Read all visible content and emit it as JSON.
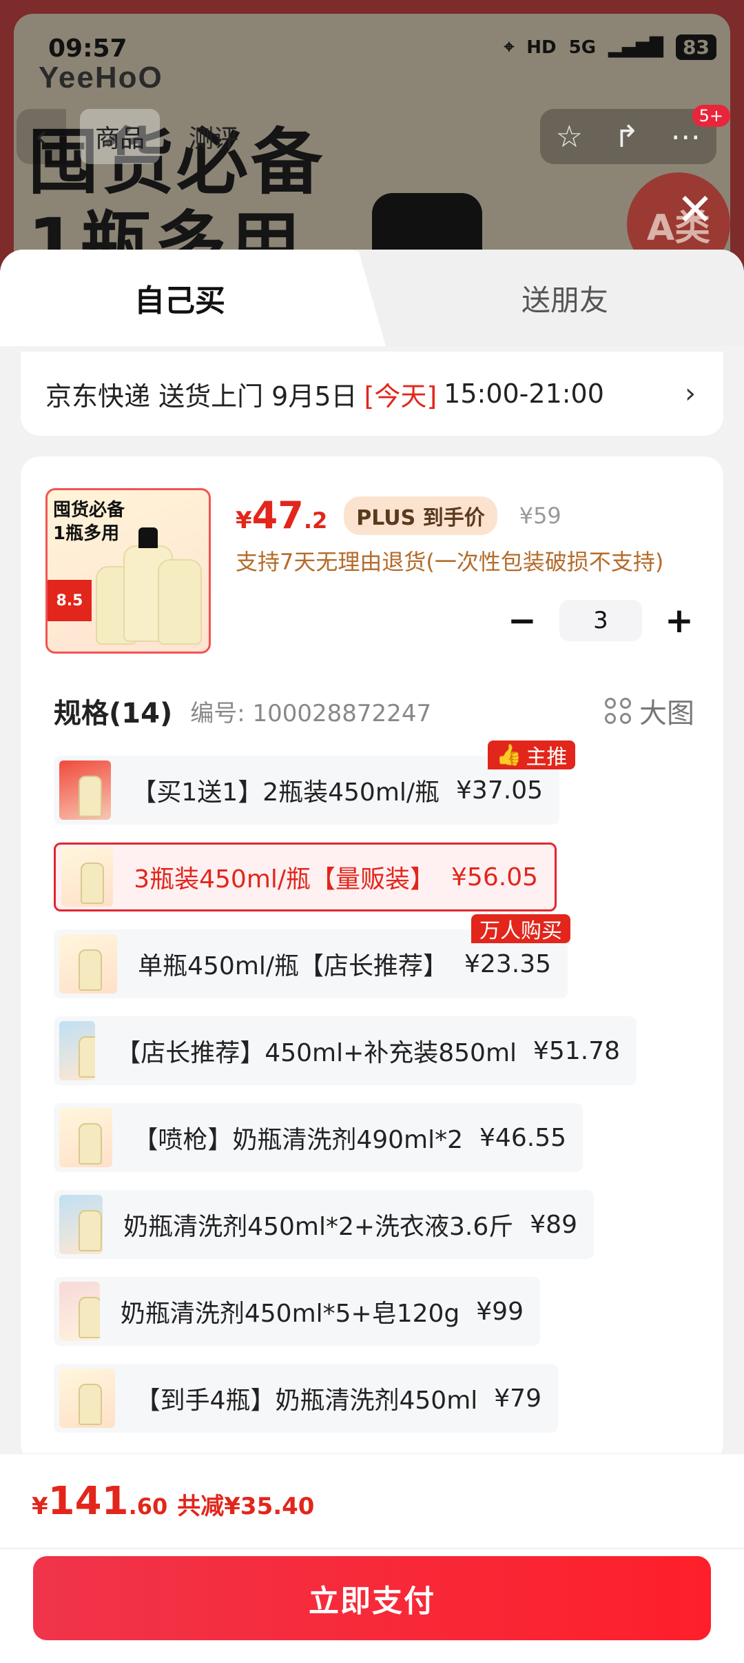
{
  "status_bar": {
    "time": "09:57",
    "network": "5G",
    "battery": "83"
  },
  "background_page": {
    "logo": "YeeHoO",
    "slogan_line1": "囤货必备",
    "slogan_line2": "1瓶多用",
    "nav_tabs": [
      "商品",
      "测评"
    ],
    "badge_count": "5+",
    "stamp_text": "A类"
  },
  "sheet": {
    "tabs": {
      "self_buy": "自己买",
      "gift": "送朋友"
    },
    "delivery": {
      "prefix": "京东快递 送货上门 9月5日",
      "today": "[今天]",
      "time": "15:00-21:00"
    },
    "product": {
      "thumb_text": "囤货必备\n1瓶多用",
      "thumb_badge": "8.5",
      "price_symbol": "¥",
      "price_int": "47",
      "price_dec": ".2",
      "plus_label": "PLUS 到手价",
      "original_price": "¥59",
      "policy": "支持7天无理由退货(一次性包装破损不支持)",
      "quantity": "3"
    },
    "spec": {
      "title": "规格(14)",
      "code_label": "编号: 100028872247",
      "big_image_label": "大图",
      "options": [
        {
          "text": "【买1送1】2瓶装450ml/瓶",
          "price": "¥37.05",
          "tag": "主推"
        },
        {
          "text": "3瓶装450ml/瓶【量贩装】",
          "price": "¥56.05",
          "selected": true
        },
        {
          "text": "单瓶450ml/瓶【店长推荐】",
          "price": "¥23.35",
          "tag": "万人购买"
        },
        {
          "text": "【店长推荐】450ml+补充装850ml",
          "price": "¥51.78"
        },
        {
          "text": "【喷枪】奶瓶清洗剂490ml*2",
          "price": "¥46.55"
        },
        {
          "text": "奶瓶清洗剂450ml*2+洗衣液3.6斤",
          "price": "¥89"
        },
        {
          "text": "奶瓶清洗剂450ml*5+皂120g",
          "price": "¥99"
        },
        {
          "text": "【到手4瓶】奶瓶清洗剂450ml",
          "price": "¥79"
        }
      ]
    }
  },
  "bottom": {
    "total_symbol": "¥",
    "total_int": "141",
    "total_dec": ".60",
    "savings": "共减¥35.40",
    "pay_label": "立即支付"
  }
}
